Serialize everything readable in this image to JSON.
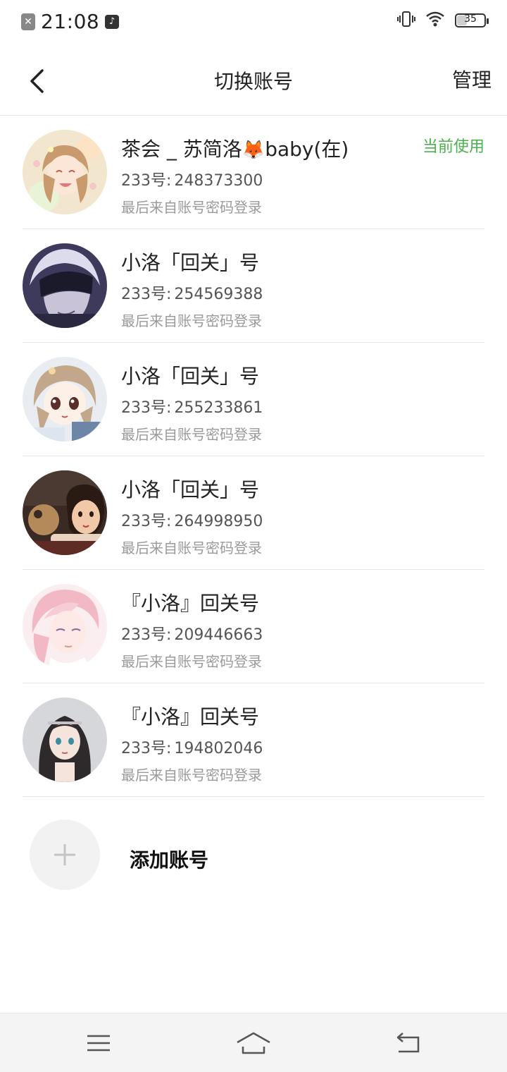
{
  "status_bar": {
    "time": "21:08",
    "battery": "35",
    "battery_level": 0.35
  },
  "header": {
    "title": "切换账号",
    "manage_label": "管理"
  },
  "id_prefix": "233号:",
  "accounts": [
    {
      "name": "茶会 _ 苏简洛",
      "name_suffix": "baby(在)",
      "emoji": "🦊",
      "id": "248373300",
      "login_method": "最后来自账号密码登录",
      "current_tag": "当前使用"
    },
    {
      "name": "小洛「回关」号",
      "id": "254569388",
      "login_method": "最后来自账号密码登录"
    },
    {
      "name": "小洛「回关」号",
      "id": "255233861",
      "login_method": "最后来自账号密码登录"
    },
    {
      "name": "小洛「回关」号",
      "id": "264998950",
      "login_method": "最后来自账号密码登录"
    },
    {
      "name": "『小洛』回关号",
      "id": "209446663",
      "login_method": "最后来自账号密码登录"
    },
    {
      "name": "『小洛』回关号",
      "id": "194802046",
      "login_method": "最后来自账号密码登录"
    }
  ],
  "add_account": {
    "label": "添加账号"
  },
  "colors": {
    "accent_green": "#4caf50",
    "divider": "#e8e8e8",
    "nav_bg": "#f4f4f4"
  },
  "icons": {
    "back": "chevron-left-icon",
    "add": "plus-icon",
    "nav_menu": "menu-icon",
    "nav_home": "home-icon",
    "nav_back": "back-icon"
  }
}
